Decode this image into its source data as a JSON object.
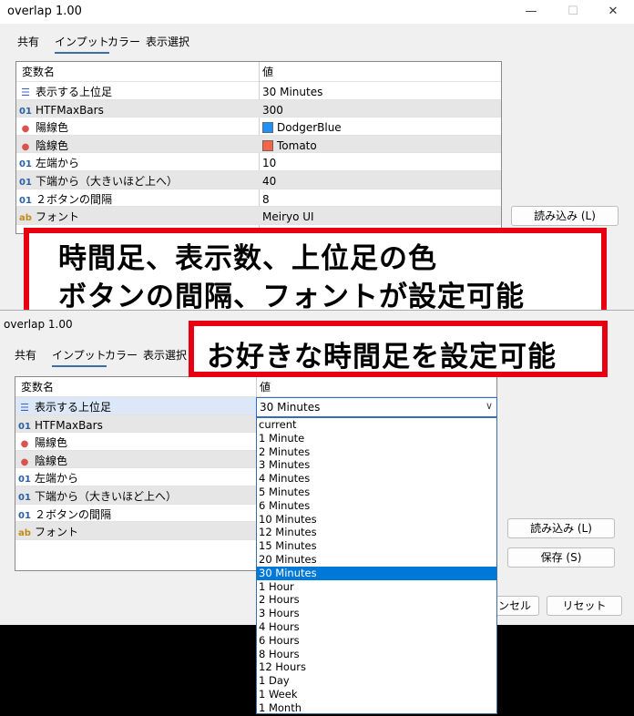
{
  "window": {
    "title": "overlap 1.00",
    "controls": {
      "minimize": "—",
      "maximize": "☐",
      "close": "✕"
    }
  },
  "tabs": [
    "共有",
    "インプット",
    "カラー",
    "表示選択"
  ],
  "table": {
    "header_name": "変数名",
    "header_value": "値"
  },
  "params": [
    {
      "icon": "enum-icon",
      "icon_text": "☰",
      "name": "表示する上位足",
      "value": "30 Minutes"
    },
    {
      "icon": "int-icon",
      "icon_text": "01",
      "name": "HTFMaxBars",
      "value": "300"
    },
    {
      "icon": "color-icon",
      "icon_text": "●",
      "name": "陽線色",
      "value": "DodgerBlue",
      "swatch": "#1e90ff"
    },
    {
      "icon": "color-icon",
      "icon_text": "●",
      "name": "陰線色",
      "value": "Tomato",
      "swatch": "#ff6347"
    },
    {
      "icon": "int-icon",
      "icon_text": "01",
      "name": "左端から",
      "value": "10"
    },
    {
      "icon": "int-icon",
      "icon_text": "01",
      "name": "下端から（大きいほど上へ）",
      "value": "40"
    },
    {
      "icon": "int-icon",
      "icon_text": "01",
      "name": "２ボタンの間隔",
      "value": "8"
    },
    {
      "icon": "string-icon",
      "icon_text": "ab",
      "name": "フォント",
      "value": "Meiryo UI"
    }
  ],
  "buttons": {
    "load": "読み込み (L)",
    "save": "保存 (S)",
    "cancel": "ンセル",
    "reset": "リセット"
  },
  "combo": {
    "value": "30 Minutes",
    "chevron": "∨"
  },
  "dropdown_options": [
    "current",
    "1 Minute",
    "2 Minutes",
    "3 Minutes",
    "4 Minutes",
    "5 Minutes",
    "6 Minutes",
    "10 Minutes",
    "12 Minutes",
    "15 Minutes",
    "20 Minutes",
    "30 Minutes",
    "1 Hour",
    "2 Hours",
    "3 Hours",
    "4 Hours",
    "6 Hours",
    "8 Hours",
    "12 Hours",
    "1 Day",
    "1 Week",
    "1 Month"
  ],
  "dropdown_selected": "30 Minutes",
  "annotations": {
    "line1": "時間足、表示数、上位足の色",
    "line2": "ボタンの間隔、フォントが設定可能",
    "line3": "お好きな時間足を設定可能"
  },
  "colors": {
    "accent": "#0078d7",
    "annotation_border": "#e60012"
  }
}
